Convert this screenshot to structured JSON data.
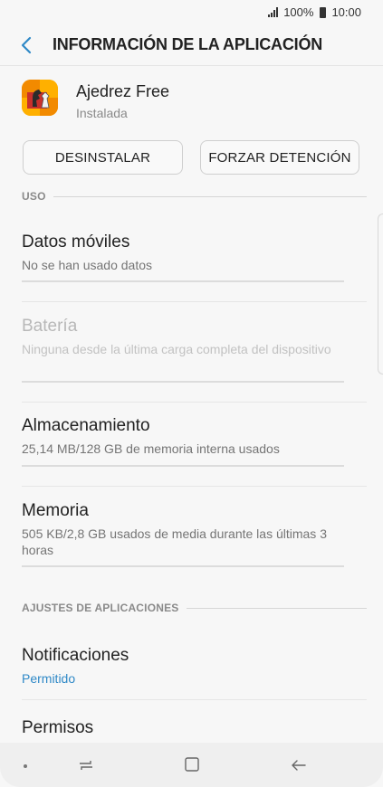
{
  "status_bar": {
    "battery": "100%",
    "time": "10:00"
  },
  "header": {
    "title": "INFORMACIÓN DE LA APLICACIÓN"
  },
  "app": {
    "name": "Ajedrez Free",
    "status": "Instalada"
  },
  "buttons": {
    "uninstall": "DESINSTALAR",
    "force_stop": "FORZAR DETENCIÓN"
  },
  "sections": {
    "usage": "USO",
    "app_settings": "AJUSTES DE APLICACIONES"
  },
  "items": {
    "mobile_data": {
      "title": "Datos móviles",
      "summary": "No se han usado datos"
    },
    "battery": {
      "title": "Batería",
      "summary": "Ninguna desde la última carga completa del dispositivo"
    },
    "storage": {
      "title": "Almacenamiento",
      "summary": "25,14 MB/128 GB de memoria interna usados"
    },
    "memory": {
      "title": "Memoria",
      "summary": "505 KB/2,8 GB usados de media durante las últimas 3 horas"
    },
    "notifications": {
      "title": "Notificaciones",
      "summary": "Permitido"
    },
    "permissions": {
      "title": "Permisos"
    }
  },
  "colors": {
    "accent": "#2f89c7",
    "app_icon": "#ffb000"
  },
  "icons": [
    "signal-icon",
    "battery-icon",
    "back-arrow-icon",
    "chess-app-icon",
    "recents-icon",
    "home-icon",
    "nav-back-icon"
  ]
}
